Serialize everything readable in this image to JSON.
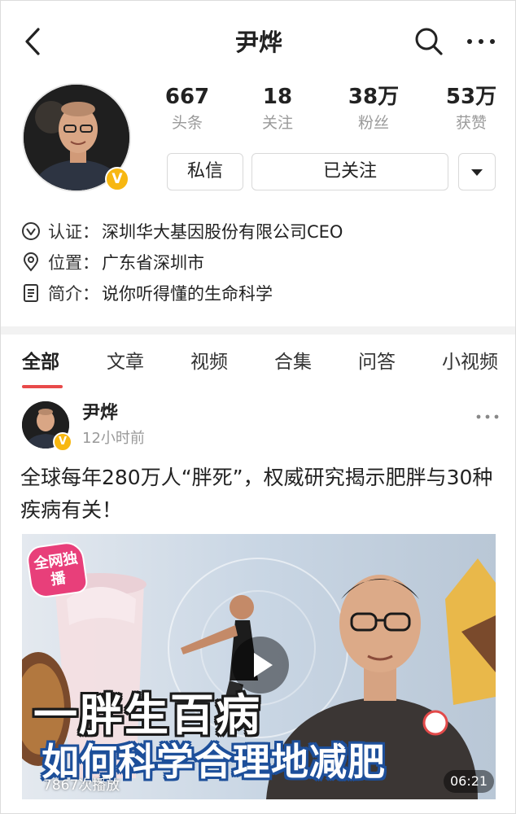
{
  "header": {
    "title": "尹烨",
    "back_icon": "chevron-left-icon",
    "search_icon": "search-icon",
    "more_icon": "more-horizontal-icon"
  },
  "profile": {
    "badge": "V",
    "stats": [
      {
        "value": "667",
        "label": "头条"
      },
      {
        "value": "18",
        "label": "关注"
      },
      {
        "value": "38万",
        "label": "粉丝"
      },
      {
        "value": "53万",
        "label": "获赞"
      }
    ],
    "message_button": "私信",
    "follow_button": "已关注",
    "dropdown_icon": "caret-down-icon",
    "info": [
      {
        "icon": "verified-icon",
        "key": "认证：",
        "value": "深圳华大基因股份有限公司CEO"
      },
      {
        "icon": "location-icon",
        "key": "位置：",
        "value": "广东省深圳市"
      },
      {
        "icon": "document-icon",
        "key": "简介：",
        "value": "说你听得懂的生命科学"
      }
    ]
  },
  "tabs": [
    {
      "label": "全部",
      "active": true
    },
    {
      "label": "文章",
      "active": false
    },
    {
      "label": "视频",
      "active": false
    },
    {
      "label": "合集",
      "active": false
    },
    {
      "label": "问答",
      "active": false
    },
    {
      "label": "小视频",
      "active": false
    }
  ],
  "post": {
    "author": "尹烨",
    "time": "12小时前",
    "title": "全球每年280万人“胖死”，权威研究揭示肥胖与30种疾病有关！",
    "video": {
      "exclusive_tag": "全网独播",
      "headline_1": "一胖生百病",
      "headline_2": "如何科学合理地减肥",
      "play_count": "7867次播放",
      "duration": "06:21"
    }
  },
  "colors": {
    "accent_red": "#e84a4a",
    "badge_gold": "#f7b711",
    "muted_text": "#9a9a9a"
  }
}
